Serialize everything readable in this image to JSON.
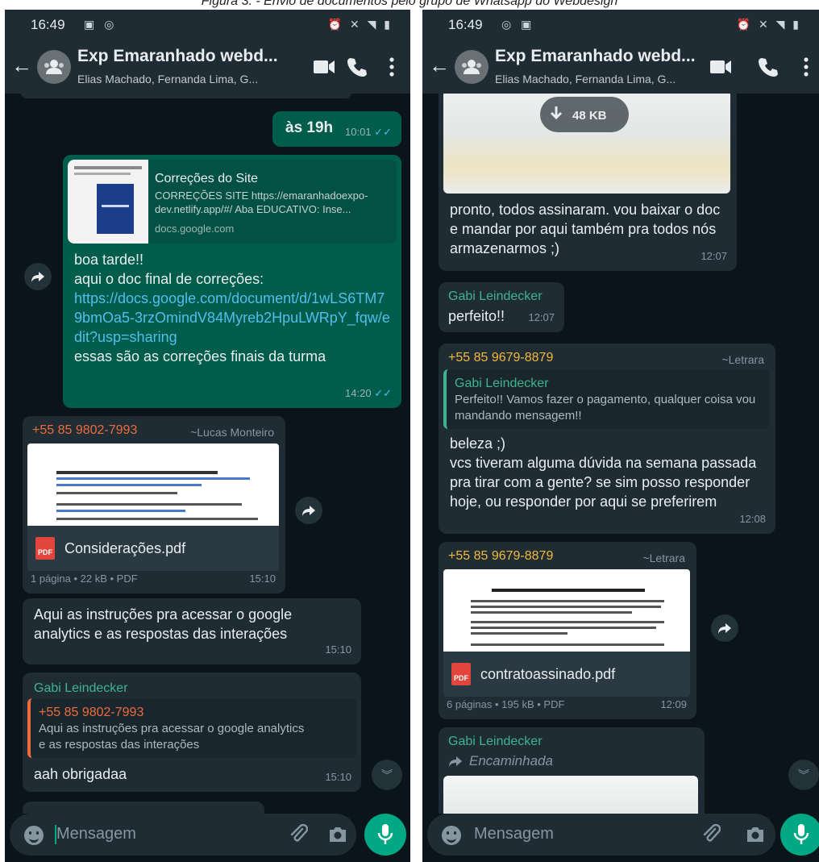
{
  "caption": "Figura 3. - Envio de documentos pelo grupo de Whatsapp do Webdesign",
  "left": {
    "status_time": "16:49",
    "chat_title": "Exp Emaranhado webd...",
    "chat_members": "Elias Machado, Fernanda Lima, G...",
    "msg1": {
      "text": "às 19h",
      "time": "10:01"
    },
    "msg2": {
      "link_title": "Correções do Site",
      "link_desc": "CORREÇÕES SITE https://emaranhadoexpo-dev.netlify.app/#/ Aba EDUCATIVO: Inse...",
      "link_domain": "docs.google.com",
      "line1": "boa tarde!!",
      "line2": "aqui o doc final de correções:",
      "url": "https://docs.google.com/document/d/1wLS6TM79bmOa5-3rzOmindV84Myreb2HpuLWRpY_fqw/edit?usp=sharing",
      "line3": "essas são as correções finais da turma",
      "time": "14:20"
    },
    "msg3": {
      "sender": "+55 85 9802-7993",
      "alias": "~Lucas Monteiro",
      "doc_name": "Considerações.pdf",
      "doc_info": "1 página • 22 kB • PDF",
      "time": "15:10"
    },
    "msg4": {
      "text": "Aqui as instruções pra acessar o google analytics e as respostas das interações",
      "time": "15:10"
    },
    "msg5": {
      "sender": "Gabi Leindecker",
      "quote_sender": "+55 85 9802-7993",
      "quote_text": "Aqui as instruções pra acessar o google analytics e as respostas das interações",
      "text": "aah obrigadaa",
      "time": "15:10"
    },
    "input_placeholder": "Mensagem"
  },
  "right": {
    "status_time": "16:49",
    "chat_title": "Exp Emaranhado webd...",
    "chat_members": "Elias Machado, Fernanda Lima, G...",
    "msg1": {
      "download_size": "48 KB",
      "text": "pronto, todos assinaram. vou baixar o doc e mandar por aqui também pra todos nós armazenarmos ;)",
      "time": "12:07"
    },
    "msg2": {
      "sender": "Gabi Leindecker",
      "text": "perfeito!!",
      "time": "12:07"
    },
    "msg3": {
      "sender": "+55 85 9679-8879",
      "alias": "~Letrara",
      "quote_sender": "Gabi Leindecker",
      "quote_text": "Perfeito!! Vamos fazer o pagamento, qualquer coisa vou mandando mensagem!!",
      "line1": "beleza ;)",
      "line2": "vcs tiveram alguma dúvida na semana passada pra tirar com a gente? se sim posso responder hoje, ou responder por aqui se preferirem",
      "time": "12:08"
    },
    "msg4": {
      "sender": "+55 85 9679-8879",
      "alias": "~Letrara",
      "doc_name": "contratoassinado.pdf",
      "doc_info": "6 páginas • 195 kB • PDF",
      "time": "12:09"
    },
    "msg5": {
      "sender": "Gabi Leindecker",
      "forwarded": "Encaminhada"
    },
    "input_placeholder": "Mensagem"
  },
  "colors": {
    "bg": "#0b141a",
    "bar": "#1f2c34",
    "outgoing": "#005c4b",
    "incoming": "#1f2c34",
    "accent": "#00a884",
    "link": "#53bdeb"
  }
}
